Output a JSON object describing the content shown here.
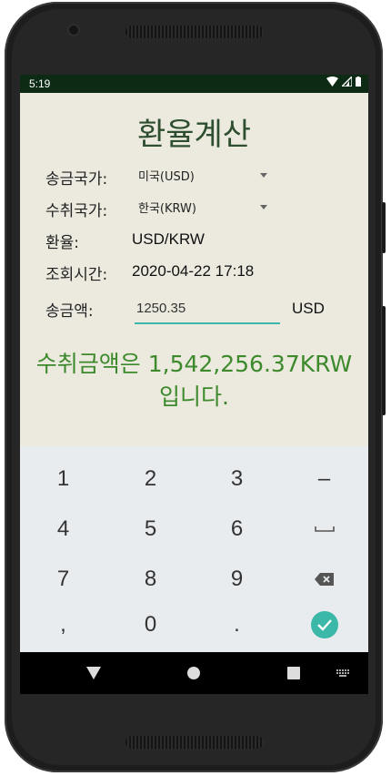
{
  "status_bar": {
    "time": "5:19"
  },
  "app": {
    "title": "환율계산",
    "sending_country_label": "송금국가:",
    "sending_country_value": "미국(USD)",
    "receiving_country_label": "수취국가:",
    "receiving_country_value": "한국(KRW)",
    "rate_label": "환율:",
    "rate_value": "USD/KRW",
    "time_label": "조회시간:",
    "time_value": "2020-04-22 17:18",
    "amount_label": "송금액:",
    "amount_value": "1250.35",
    "amount_unit": "USD",
    "result_line1": "수취금액은 1,542,256.37KRW",
    "result_line2": "입니다."
  },
  "keyboard": {
    "keys": [
      "1",
      "2",
      "3",
      "–",
      "4",
      "5",
      "6",
      "space",
      "7",
      "8",
      "9",
      "backspace",
      ",",
      "0",
      ".",
      "done"
    ],
    "labels": {
      "k1": "1",
      "k2": "2",
      "k3": "3",
      "minus": "–",
      "k4": "4",
      "k5": "5",
      "k6": "6",
      "k7": "7",
      "k8": "8",
      "k9": "9",
      "comma": ",",
      "k0": "0",
      "period": "."
    }
  },
  "colors": {
    "accent": "#3bb8a8",
    "result": "#3c8a2c",
    "title": "#2e4f2f",
    "screen_bg": "#ece9df",
    "status_bar": "#0d2b14"
  }
}
